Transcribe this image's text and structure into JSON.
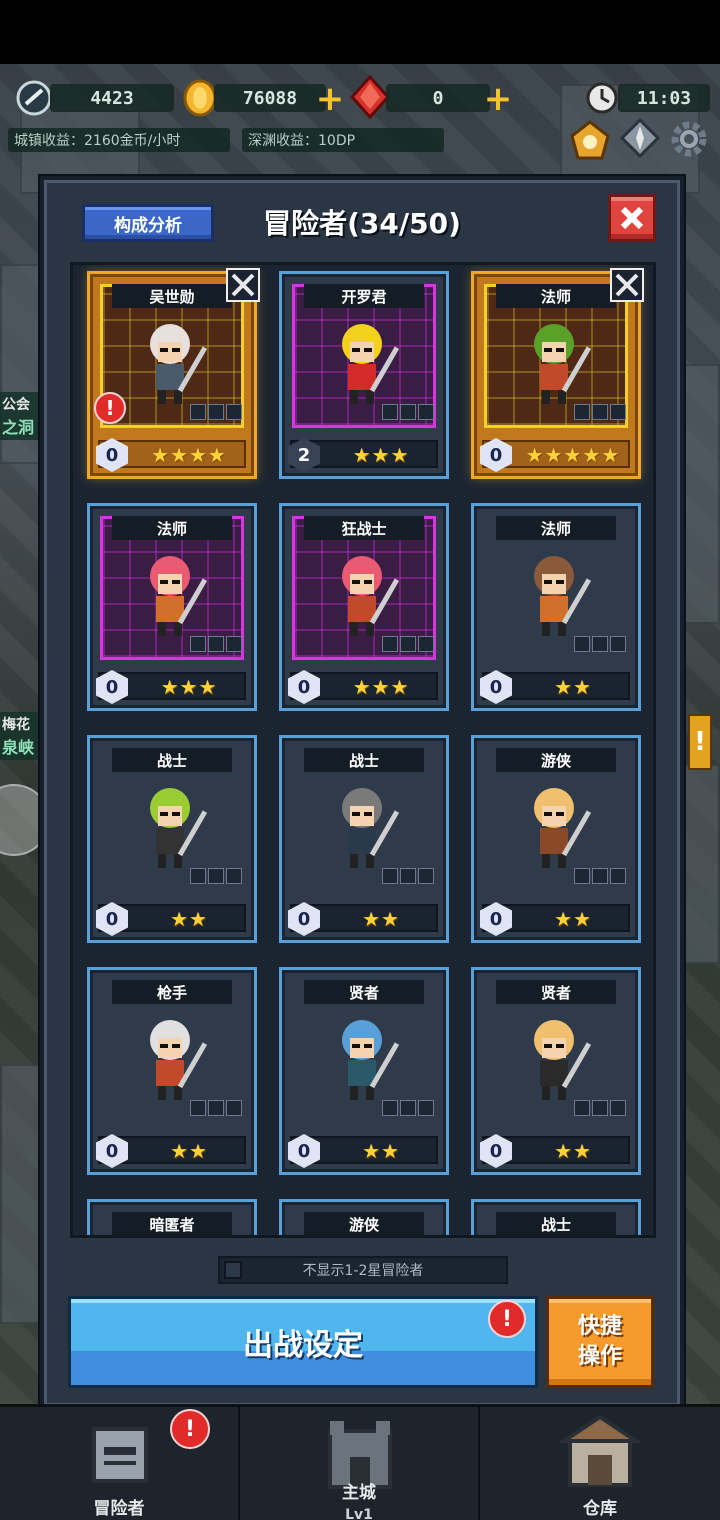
{
  "hud": {
    "energy": "4423",
    "gold": "76088",
    "gems": "0",
    "time": "11:03",
    "town_income": "城镇收益：2160金币/小时",
    "abyss_income": "深渊收益：10DP"
  },
  "side": {
    "tag1_top": "公会",
    "tag1_bottom": "之洞",
    "tag2_top": "梅花",
    "tag2_bottom": "泉峡"
  },
  "modal": {
    "title": "冒险者(34/50)",
    "analysis_label": "构成分析",
    "filter_label": "不显示1-2星冒险者",
    "deploy_label": "出战设定",
    "quick_label_1": "快捷",
    "quick_label_2": "操作",
    "alert_glyph": "!"
  },
  "cards": [
    {
      "name": "吴世勋",
      "level": "0",
      "stars": "★★★★"
    },
    {
      "name": "开罗君",
      "level": "2",
      "stars": "★★★"
    },
    {
      "name": "法师",
      "level": "0",
      "stars": "★★★★★"
    },
    {
      "name": "法师",
      "level": "0",
      "stars": "★★★"
    },
    {
      "name": "狂战士",
      "level": "0",
      "stars": "★★★"
    },
    {
      "name": "法师",
      "level": "0",
      "stars": "★★"
    },
    {
      "name": "战士",
      "level": "0",
      "stars": "★★"
    },
    {
      "name": "战士",
      "level": "0",
      "stars": "★★"
    },
    {
      "name": "游侠",
      "level": "0",
      "stars": "★★"
    },
    {
      "name": "枪手",
      "level": "0",
      "stars": "★★"
    },
    {
      "name": "贤者",
      "level": "0",
      "stars": "★★"
    },
    {
      "name": "贤者",
      "level": "0",
      "stars": "★★"
    },
    {
      "name": "暗匿者",
      "level": "",
      "stars": ""
    },
    {
      "name": "游侠",
      "level": "",
      "stars": ""
    },
    {
      "name": "战士",
      "level": "",
      "stars": ""
    }
  ],
  "nav": {
    "adventurers": "冒险者",
    "main_city": "主城",
    "main_city_level": "Lv1",
    "warehouse": "仓库"
  },
  "colors": {
    "gold_frame": "#f0a828",
    "blue_frame": "#5aa0d8",
    "purple_frame": "#d635e0",
    "deploy_blue": "#4fb6ee",
    "quick_orange": "#f59a2c",
    "close_red": "#e0443f"
  }
}
